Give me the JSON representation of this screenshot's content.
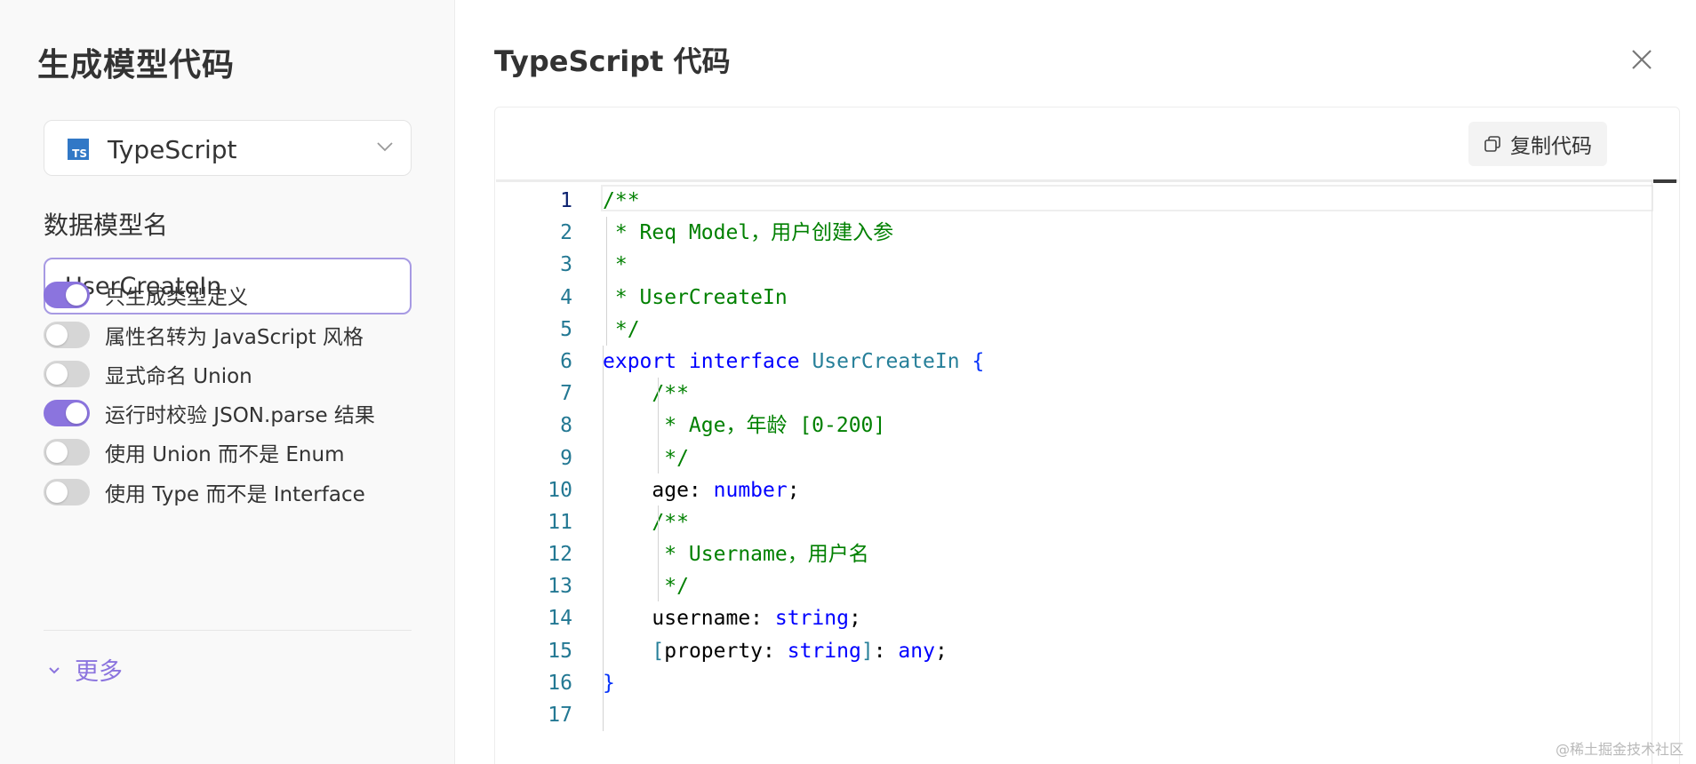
{
  "left_panel": {
    "title": "生成模型代码",
    "language_select": {
      "icon": "typescript-icon",
      "icon_text": "TS",
      "value": "TypeScript"
    },
    "model_name": {
      "label": "数据模型名",
      "value": "UserCreateIn"
    },
    "toggles": [
      {
        "label": "只生成类型定义",
        "on": true
      },
      {
        "label": "属性名转为 JavaScript 风格",
        "on": false
      },
      {
        "label": "显式命名 Union",
        "on": false
      },
      {
        "label": "运行时校验 JSON.parse 结果",
        "on": true
      },
      {
        "label": "使用 Union 而不是 Enum",
        "on": false
      },
      {
        "label": "使用 Type 而不是 Interface",
        "on": false
      }
    ],
    "more_label": "更多"
  },
  "right_panel": {
    "title": "TypeScript 代码",
    "copy_label": "复制代码",
    "code_lines": [
      {
        "num": "1",
        "tokens": [
          {
            "t": "/**",
            "c": "comment"
          }
        ]
      },
      {
        "num": "2",
        "tokens": [
          {
            "t": " * Req Model，用户创建入参",
            "c": "comment"
          }
        ]
      },
      {
        "num": "3",
        "tokens": [
          {
            "t": " *",
            "c": "comment"
          }
        ]
      },
      {
        "num": "4",
        "tokens": [
          {
            "t": " * UserCreateIn",
            "c": "comment"
          }
        ]
      },
      {
        "num": "5",
        "tokens": [
          {
            "t": " */",
            "c": "comment"
          }
        ]
      },
      {
        "num": "6",
        "tokens": [
          {
            "t": "export",
            "c": "kw"
          },
          {
            "t": " ",
            "c": "plain"
          },
          {
            "t": "interface",
            "c": "kw"
          },
          {
            "t": " ",
            "c": "plain"
          },
          {
            "t": "UserCreateIn",
            "c": "type"
          },
          {
            "t": " {",
            "c": "punc"
          }
        ]
      },
      {
        "num": "7",
        "tokens": [
          {
            "t": "    /**",
            "c": "comment"
          }
        ]
      },
      {
        "num": "8",
        "tokens": [
          {
            "t": "     * Age，年龄 [0-200]",
            "c": "comment"
          }
        ]
      },
      {
        "num": "9",
        "tokens": [
          {
            "t": "     */",
            "c": "comment"
          }
        ]
      },
      {
        "num": "10",
        "tokens": [
          {
            "t": "    age: ",
            "c": "plain"
          },
          {
            "t": "number",
            "c": "kw"
          },
          {
            "t": ";",
            "c": "plain"
          }
        ]
      },
      {
        "num": "11",
        "tokens": [
          {
            "t": "    /**",
            "c": "comment"
          }
        ]
      },
      {
        "num": "12",
        "tokens": [
          {
            "t": "     * Username，用户名",
            "c": "comment"
          }
        ]
      },
      {
        "num": "13",
        "tokens": [
          {
            "t": "     */",
            "c": "comment"
          }
        ]
      },
      {
        "num": "14",
        "tokens": [
          {
            "t": "    username: ",
            "c": "plain"
          },
          {
            "t": "string",
            "c": "kw"
          },
          {
            "t": ";",
            "c": "plain"
          }
        ]
      },
      {
        "num": "15",
        "tokens": [
          {
            "t": "    ",
            "c": "plain"
          },
          {
            "t": "[",
            "c": "type"
          },
          {
            "t": "property: ",
            "c": "plain"
          },
          {
            "t": "string",
            "c": "kw"
          },
          {
            "t": "]",
            "c": "type"
          },
          {
            "t": ": ",
            "c": "plain"
          },
          {
            "t": "any",
            "c": "kw"
          },
          {
            "t": ";",
            "c": "plain"
          }
        ]
      },
      {
        "num": "16",
        "tokens": [
          {
            "t": "}",
            "c": "punc"
          }
        ]
      },
      {
        "num": "17",
        "tokens": []
      }
    ]
  },
  "watermark": "@稀土掘金技术社区",
  "colors": {
    "accent": "#8b74de",
    "comment": "#008000",
    "keyword": "#0000ff",
    "type": "#267f99",
    "line_number": "#237893"
  }
}
